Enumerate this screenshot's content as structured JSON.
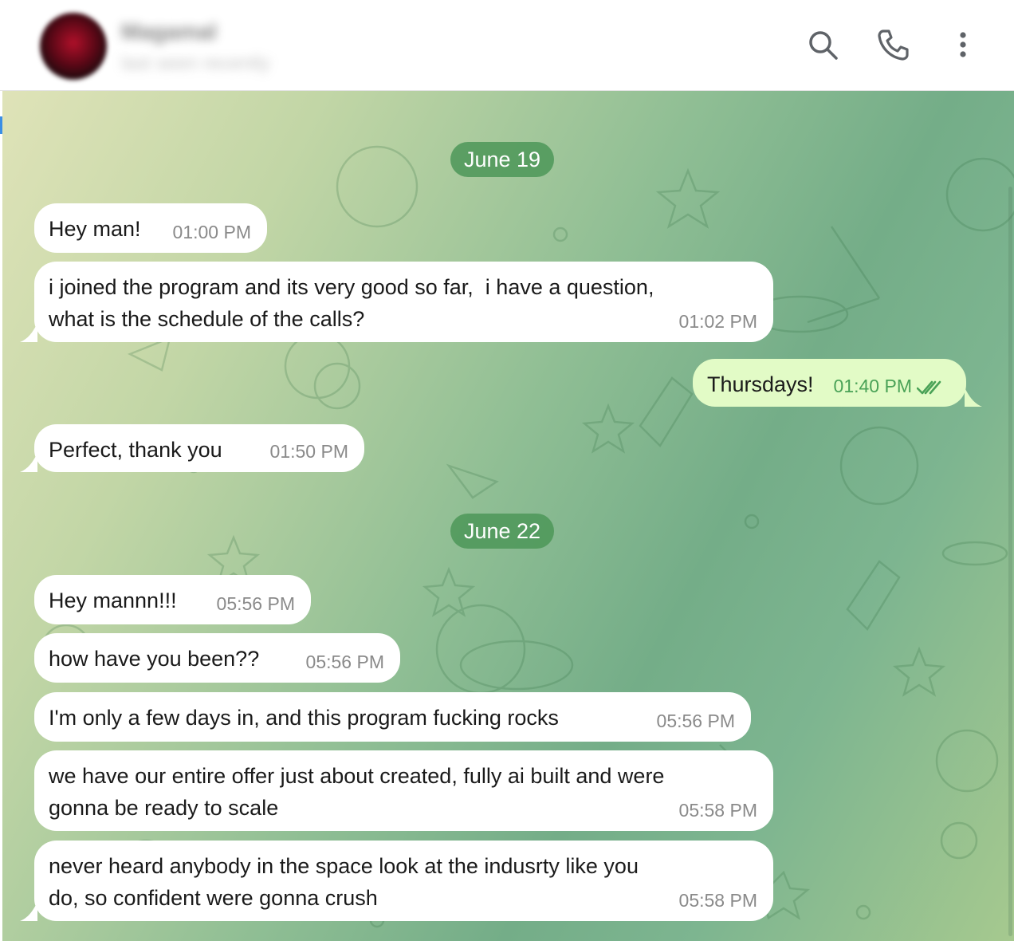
{
  "header": {
    "contact_name": "Magamal",
    "contact_status": "last seen recently",
    "search_icon": "search-icon",
    "call_icon": "phone-icon",
    "menu_icon": "more-vertical-icon"
  },
  "colors": {
    "date_pill": "#4c9658",
    "incoming_bubble": "#ffffff",
    "outgoing_bubble": "#e2fbc6",
    "outgoing_time": "#4aa257"
  },
  "dates": [
    "June 19",
    "June 22"
  ],
  "messages": [
    {
      "direction": "in",
      "text": "Hey man!",
      "time": "01:00 PM"
    },
    {
      "direction": "in",
      "text": "i joined the program and its very good so far,  i have a question,\nwhat is the schedule of the calls?",
      "time": "01:02 PM"
    },
    {
      "direction": "out",
      "text": "Thursdays!",
      "time": "01:40 PM",
      "status": "read"
    },
    {
      "direction": "in",
      "text": "Perfect, thank you",
      "time": "01:50 PM"
    },
    {
      "direction": "in",
      "text": "Hey mannn!!!",
      "time": "05:56 PM"
    },
    {
      "direction": "in",
      "text": "how have you been??",
      "time": "05:56 PM"
    },
    {
      "direction": "in",
      "text": "I'm only a few days in, and this program fucking rocks",
      "time": "05:56 PM"
    },
    {
      "direction": "in",
      "text": "we have our entire offer just about created, fully ai built and were\ngonna be ready to scale",
      "time": "05:58 PM"
    },
    {
      "direction": "in",
      "text": "never heard anybody in the space look at the indusrty like you\ndo, so confident were gonna crush",
      "time": "05:58 PM"
    }
  ]
}
